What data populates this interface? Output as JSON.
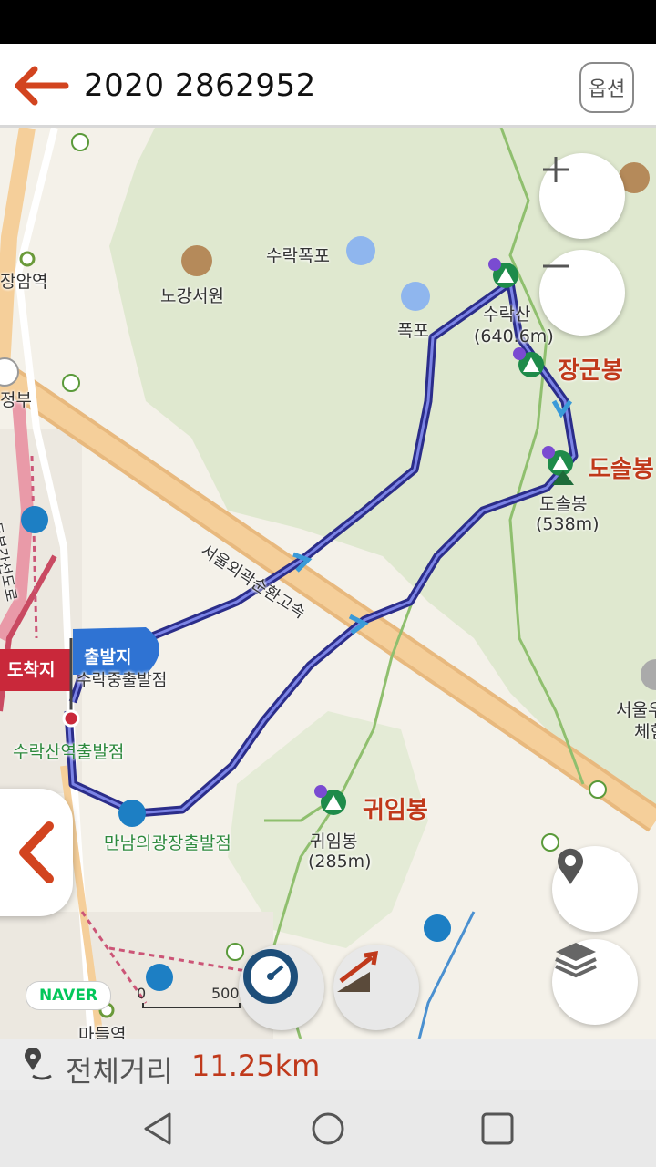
{
  "header": {
    "title": "2020 2862952",
    "option_label": "옵션"
  },
  "map_labels": {
    "jangam_station": "장암역",
    "nogang_seowon": "노강서원",
    "surak_falls": "수락폭포",
    "falls": "폭포",
    "jeongbu": "정부",
    "expressway": "서울외곽순환고속",
    "jangunbong_big": "장군봉",
    "dosolbong_big": "도솔봉",
    "dosolbong_small": "도솔봉",
    "dosolbong_height": "(538m)",
    "surak_peak": "수락산",
    "surak_height": "(640.6m)",
    "gwiimbong_big": "귀임봉",
    "gwiimbong_small": "귀임봉",
    "gwiimbong_height": "(285m)",
    "start_flag": "출발지",
    "end_flag": "도착지",
    "start_point": "수락중출발점",
    "surak_station_start": "수락산역출발점",
    "mannam_start": "만남의광장출발점",
    "madeul_station": "마들역",
    "seoul_right": "서울우",
    "museum_right": "체험",
    "road_vertical": "동부간선도로"
  },
  "scale": {
    "zero": "0",
    "max": "500"
  },
  "brand": "NAVER",
  "bottom": {
    "label": "전체거리",
    "value": "11.25km"
  },
  "colors": {
    "accent": "#c0391b",
    "route": "#3a3fb5",
    "park": "#dfe8cf",
    "road": "#f2c78f"
  }
}
